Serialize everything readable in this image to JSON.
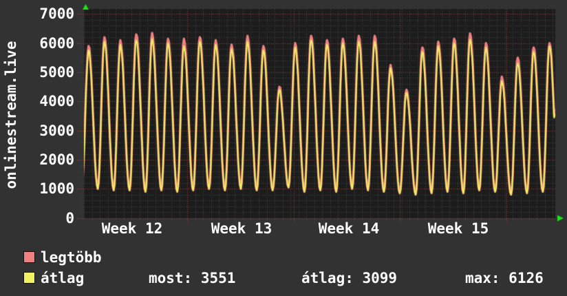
{
  "title": "onlinestream.live",
  "colors": {
    "background": "#323232",
    "plot_background": "#1c1c1c",
    "minor_grid": "#454545",
    "major_grid": "#a84040",
    "axis_arrow": "#1ae41a",
    "text": "#ffffff",
    "series_max": "#ef8181",
    "series_avg": "#f2f163"
  },
  "legend": {
    "items": [
      {
        "label": "legtöbb",
        "color": "#ef8181"
      },
      {
        "label": "átlag",
        "color": "#f2f163"
      }
    ]
  },
  "footer": {
    "most_label": "most:",
    "most_value": "3551",
    "avg_label": "átlag:",
    "avg_value": "3099",
    "max_label": "max:",
    "max_value": "6126"
  },
  "chart_data": {
    "type": "line",
    "title": "onlinestream.live",
    "xlabel": "",
    "ylabel": "",
    "ylim": [
      0,
      7000
    ],
    "y_ticks": [
      7000,
      6000,
      5000,
      4000,
      3000,
      2000,
      1000,
      0
    ],
    "y_minor_step": 200,
    "x_tick_labels": [
      "Week 12",
      "Week 13",
      "Week 14",
      "Week 15"
    ],
    "x_span_days": 30,
    "grid": "minor gray dashed half-day/200-unit, major red dotted weekly/1000-unit",
    "legend_position": "bottom-left",
    "series": [
      {
        "name": "legtöbb",
        "color": "#ef8181",
        "daily_peaks": [
          5900,
          6200,
          6100,
          6300,
          6350,
          6150,
          6150,
          6200,
          6100,
          5950,
          6250,
          5900,
          4500,
          6000,
          6250,
          6100,
          6150,
          6250,
          6250,
          5250,
          4400,
          5850,
          6050,
          6150,
          6330,
          6000,
          4850,
          5500,
          5850,
          6000
        ],
        "last_value": 3700
      },
      {
        "name": "átlag",
        "color": "#f2f163",
        "daily_peaks": [
          5750,
          6050,
          5950,
          6100,
          6150,
          6000,
          5900,
          6050,
          5950,
          5800,
          6050,
          5750,
          4400,
          5850,
          6100,
          5950,
          6000,
          6050,
          6050,
          5150,
          4300,
          5700,
          5900,
          6000,
          6126,
          5850,
          4700,
          5300,
          5700,
          5900
        ],
        "last_value": 3551
      }
    ],
    "daily_valleys": [
      1150,
      1000,
      950,
      950,
      900,
      950,
      900,
      950,
      1000,
      950,
      1000,
      950,
      950,
      1050,
      900,
      950,
      900,
      1000,
      950,
      900,
      850,
      800,
      850,
      900,
      850,
      950,
      900,
      800,
      850,
      900,
      900
    ],
    "stats": {
      "most": 3551,
      "átlag": 3099,
      "max": 6126
    }
  }
}
